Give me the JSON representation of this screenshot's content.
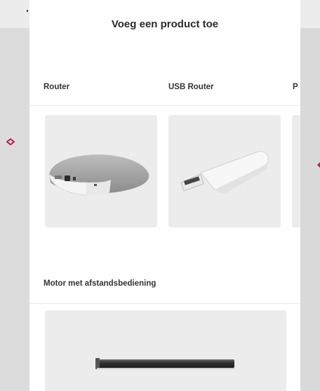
{
  "sheet": {
    "title": "Voeg een product toe"
  },
  "categories": {
    "router_label": "Router",
    "usb_router_label": "USB Router",
    "third_label_partial": "P",
    "motor_label": "Motor met afstandsbediening"
  },
  "colors": {
    "accent": "#c2185b",
    "card_bg": "#ececec",
    "sheet_bg": "#ffffff"
  },
  "icons": {
    "left_marker": "pink-diamond-icon",
    "right_marker": "pink-marker-icon"
  }
}
